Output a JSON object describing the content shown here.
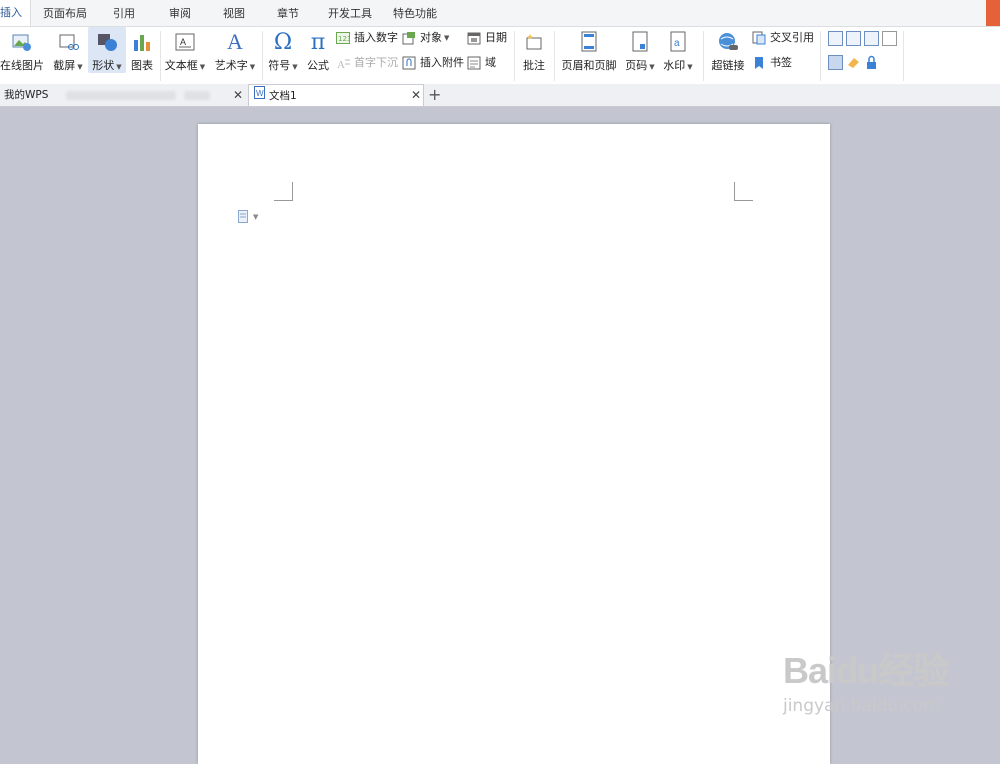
{
  "menu_tabs": [
    "插入",
    "页面布局",
    "引用",
    "审阅",
    "视图",
    "章节",
    "开发工具",
    "特色功能"
  ],
  "ribbon": {
    "online_picture": "在线图片",
    "screenshot": "截屏",
    "shape": "形状",
    "chart": "图表",
    "textbox": "文本框",
    "wordart": "艺术字",
    "symbol": "符号",
    "formula": "公式",
    "insert_number": "插入数字",
    "dropcap": "首字下沉",
    "object": "对象",
    "insert_attachment": "插入附件",
    "date": "日期",
    "field": "域",
    "comment": "批注",
    "header_footer": "页眉和页脚",
    "page_number": "页码",
    "watermark": "水印",
    "hyperlink": "超链接",
    "cross_reference": "交叉引用",
    "bookmark": "书签"
  },
  "doc_tabs": {
    "my_wps": "我的WPS",
    "document": "文档1"
  },
  "watermark": {
    "logo": "Baidu经验",
    "url": "jingyan.baidu.com"
  },
  "colors": {
    "accent": "#2b579a",
    "workspace": "#c3c6d0"
  }
}
